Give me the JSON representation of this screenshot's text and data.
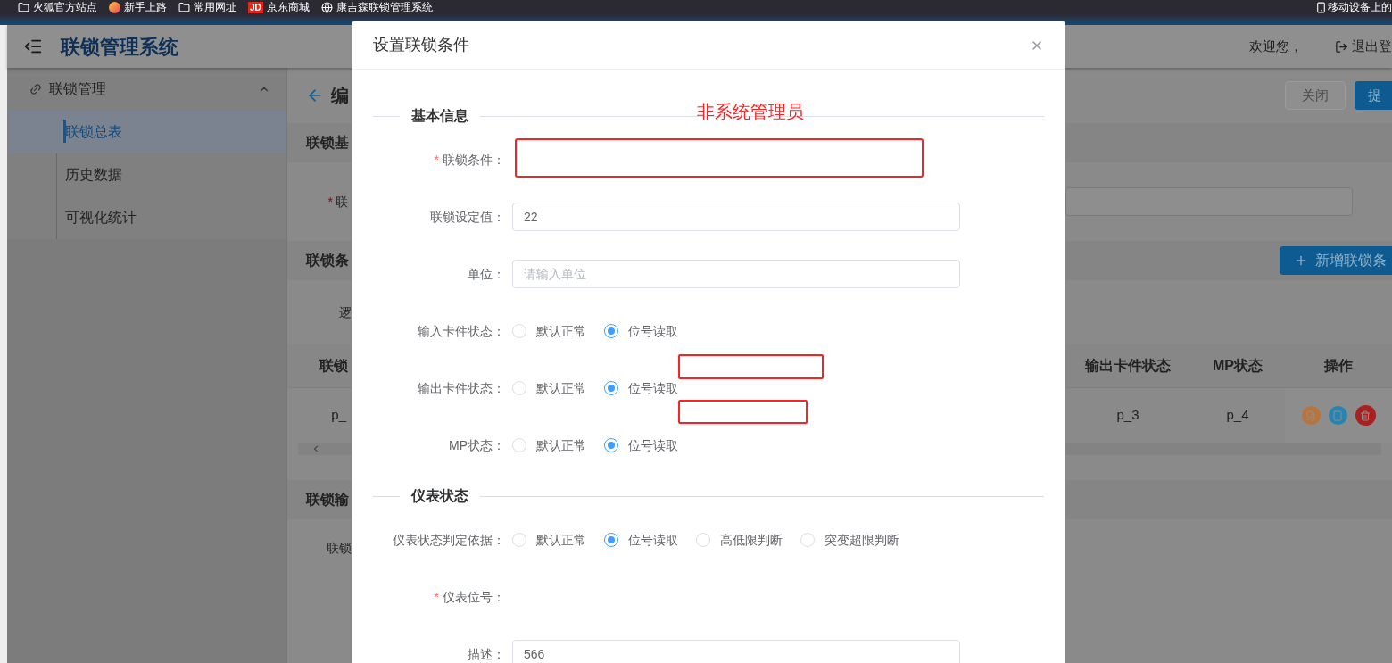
{
  "bookmarks": [
    {
      "label": "火狐官方站点",
      "kind": "folder"
    },
    {
      "label": "新手上路",
      "kind": "firefox"
    },
    {
      "label": "常用网址",
      "kind": "folder"
    },
    {
      "label": "京东商城",
      "kind": "jd",
      "badge": "JD"
    },
    {
      "label": "康吉森联锁管理系统",
      "kind": "globe"
    }
  ],
  "bookmarks_right": {
    "label": "移动设备上的"
  },
  "header": {
    "title": "联锁管理系统",
    "welcome": "欢迎您，",
    "logout": "退出登"
  },
  "sidebar": {
    "group": {
      "label": "联锁管理",
      "expanded": true
    },
    "items": [
      {
        "label": "联锁总表",
        "selected": true
      },
      {
        "label": "历史数据",
        "selected": false
      },
      {
        "label": "可视化统计",
        "selected": false
      }
    ]
  },
  "page": {
    "title": "编",
    "close_button": "关闭",
    "submit_button": "提",
    "basic_section": "联锁基",
    "basic_label": {
      "label": "联",
      "required": true
    },
    "conditions_section": "联锁条",
    "add_button": "新增联锁条",
    "logic_label": "逻",
    "table": {
      "columns": [
        "联锁",
        "输出卡件状态",
        "MP状态",
        "操作"
      ],
      "rows": [
        {
          "cells": [
            "p_",
            "p_3",
            "p_4"
          ]
        }
      ]
    },
    "output_section": "联锁输",
    "output_label": "联锁"
  },
  "required_mark": "*",
  "dialog": {
    "title": "设置联锁条件",
    "annotation": "非系统管理员",
    "sections": [
      {
        "title": "基本信息",
        "fields": [
          {
            "label": "联锁条件：",
            "required": true,
            "kind": "redacted"
          },
          {
            "label": "联锁设定值：",
            "required": false,
            "kind": "input",
            "value": "22"
          },
          {
            "label": "单位：",
            "required": false,
            "kind": "input",
            "placeholder": "请输入单位"
          },
          {
            "label": "输入卡件状态：",
            "required": false,
            "kind": "radio",
            "options": [
              {
                "label": "默认正常",
                "selected": false
              },
              {
                "label": "位号读取",
                "selected": true
              }
            ]
          },
          {
            "label": "输出卡件状态：",
            "required": false,
            "kind": "radio",
            "options": [
              {
                "label": "默认正常",
                "selected": false
              },
              {
                "label": "位号读取",
                "selected": true
              }
            ]
          },
          {
            "label": "MP状态：",
            "required": false,
            "kind": "radio",
            "options": [
              {
                "label": "默认正常",
                "selected": false
              },
              {
                "label": "位号读取",
                "selected": true
              }
            ]
          }
        ]
      },
      {
        "title": "仪表状态",
        "fields": [
          {
            "label": "仪表状态判定依据：",
            "required": false,
            "kind": "radio",
            "options": [
              {
                "label": "默认正常",
                "selected": false
              },
              {
                "label": "位号读取",
                "selected": true
              },
              {
                "label": "高低限判断",
                "selected": false
              },
              {
                "label": "突变超限判断",
                "selected": false
              }
            ]
          },
          {
            "label": "仪表位号：",
            "required": true,
            "kind": "empty"
          },
          {
            "label": "描述：",
            "required": false,
            "kind": "input",
            "value": "566"
          }
        ]
      }
    ]
  }
}
